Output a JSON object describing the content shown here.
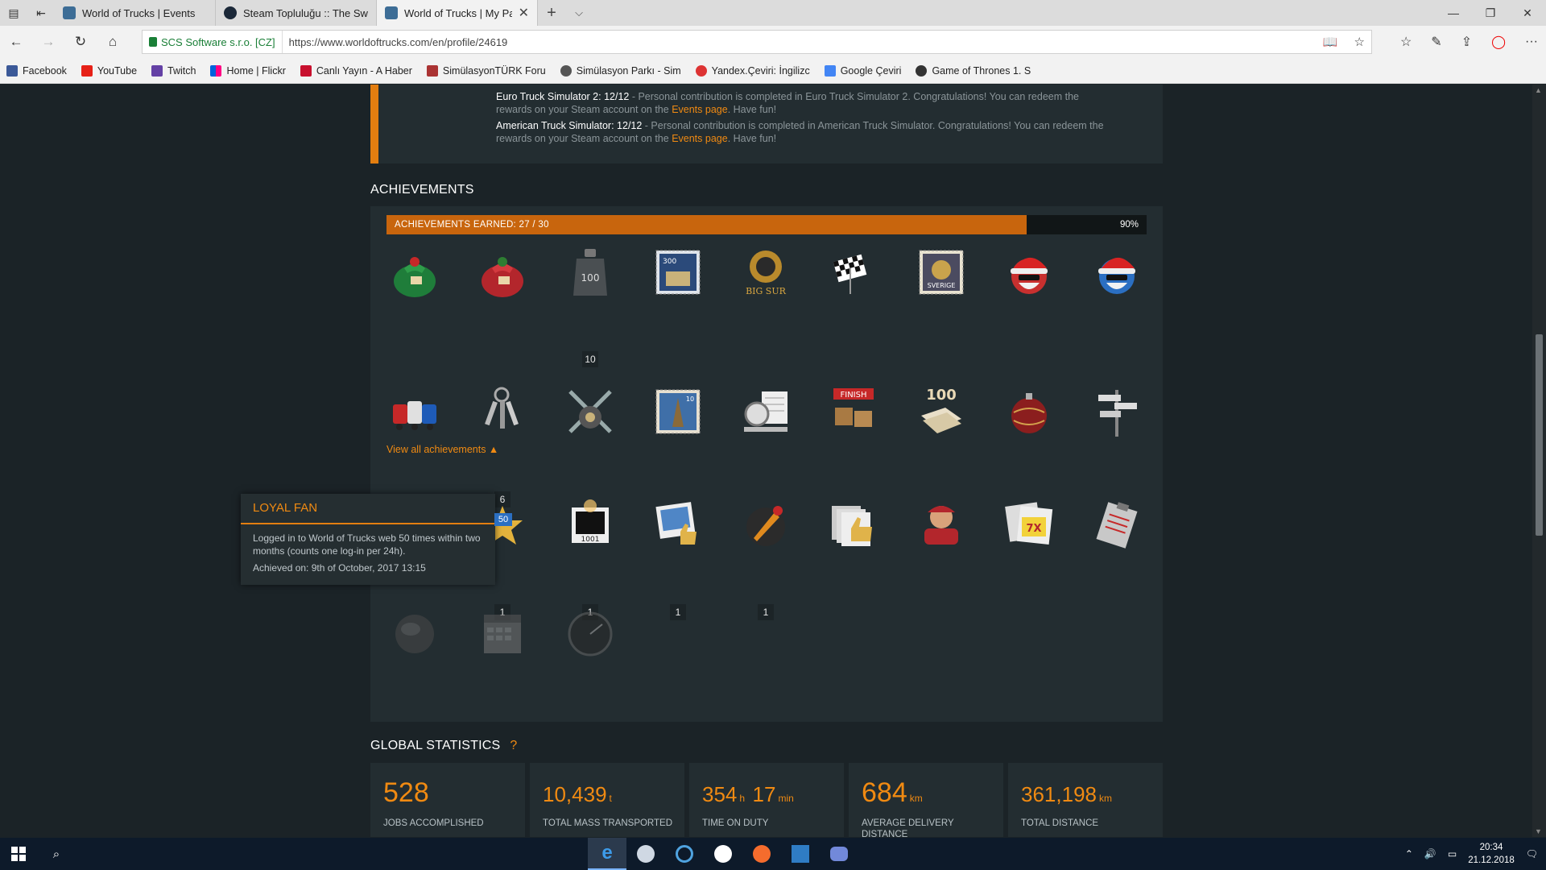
{
  "browser": {
    "tabs": [
      {
        "title": "World of Trucks | Events",
        "active": false
      },
      {
        "title": "Steam Topluluğu :: The Swo",
        "active": false
      },
      {
        "title": "World of Trucks | My Pa",
        "active": true
      }
    ],
    "cert_label": "SCS Software s.r.o. [CZ]",
    "url": "https://www.worldoftrucks.com/en/profile/24619",
    "bookmarks": [
      "Facebook",
      "YouTube",
      "Twitch",
      "Home | Flickr",
      "Canlı Yayın - A Haber",
      "SimülasyonTÜRK Foru",
      "Simülasyon Parkı - Sim",
      "Yandex.Çeviri: İngilizc",
      "Google Çeviri",
      "Game of Thrones 1. S"
    ]
  },
  "event": {
    "ets2_title": "Euro Truck Simulator 2: 12/12",
    "ets2_text_a": " - Personal contribution is completed in Euro Truck Simulator 2. Congratulations! You can redeem the",
    "ets2_text_b": "rewards on your Steam account on the ",
    "ats_title": "American Truck Simulator: 12/12",
    "ats_text_a": " - Personal contribution is completed in American Truck Simulator. Congratulations! You can redeem the",
    "ats_text_b": "rewards on your Steam account on the ",
    "events_link": "Events page",
    "have_fun": ". Have fun!"
  },
  "achievements": {
    "heading": "ACHIEVEMENTS",
    "earned_label": "ACHIEVEMENTS EARNED: 27 / 30",
    "percent_label": "90%",
    "progress_fraction": 0.9,
    "view_all": "View all achievements ▲",
    "counts": {
      "weights": "10",
      "keys": "6",
      "row3_b": "1",
      "row3_c": "1",
      "row3_d": "1",
      "row3_e": "1"
    },
    "tooltip": {
      "title": "LOYAL FAN",
      "description": "Logged in to World of Trucks web 50 times within two months (counts one log-in per 24h).",
      "achieved": "Achieved on: 9th of October, 2017 13:15",
      "badge_number": "50"
    }
  },
  "global_stats": {
    "heading": "GLOBAL STATISTICS",
    "help": "?",
    "items": [
      {
        "value": "528",
        "unit": "",
        "label": "JOBS ACCOMPLISHED"
      },
      {
        "value": "10,439",
        "unit": "t",
        "label": "TOTAL MASS TRANSPORTED"
      },
      {
        "value": "354",
        "unit": "h",
        "value2": "17",
        "unit2": "min",
        "label": "TIME ON DUTY"
      },
      {
        "value": "684",
        "unit": "km",
        "label": "AVERAGE DELIVERY DISTANCE"
      },
      {
        "value": "361,198",
        "unit": "km",
        "label": "TOTAL DISTANCE"
      }
    ]
  },
  "taskbar": {
    "time": "20:34",
    "date": "21.12.2018"
  }
}
